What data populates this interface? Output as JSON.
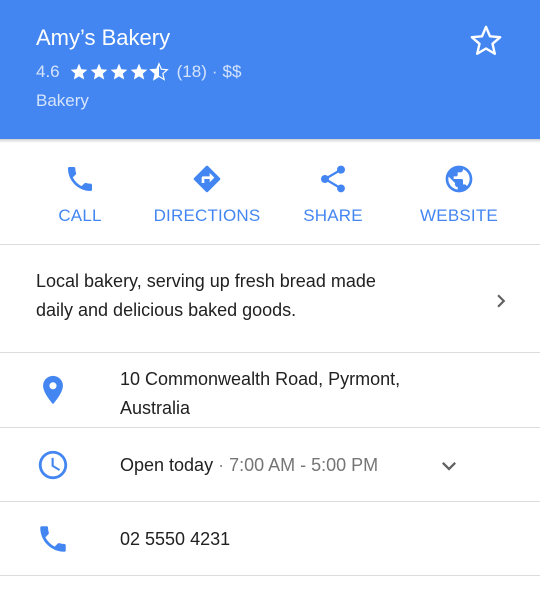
{
  "header": {
    "title": "Amy’s Bakery",
    "rating": "4.6",
    "stars": 4.5,
    "review_count": "(18)",
    "separator": "·",
    "price": "$$",
    "category": "Bakery",
    "background_color": "#4386f2",
    "favorite_icon": "star-outline-icon"
  },
  "actions": [
    {
      "label": "CALL",
      "icon": "phone-icon"
    },
    {
      "label": "DIRECTIONS",
      "icon": "directions-icon"
    },
    {
      "label": "SHARE",
      "icon": "share-icon"
    },
    {
      "label": "WEBSITE",
      "icon": "globe-icon"
    }
  ],
  "description": {
    "line1": "Local bakery, serving up fresh bread made",
    "line2": "daily and delicious baked goods.",
    "icon": "chevron-right-icon"
  },
  "address": {
    "line1": "10 Commonwealth Road, Pyrmont,",
    "line2": "Australia",
    "icon": "location-pin-icon"
  },
  "hours": {
    "status": "Open today",
    "separator": "·",
    "time": "7:00 AM - 5:00 PM",
    "icon": "clock-icon",
    "expand_icon": "chevron-down-icon"
  },
  "phone": {
    "number": "02 5550 4231",
    "icon": "phone-icon"
  },
  "accent_color": "#4386f2"
}
